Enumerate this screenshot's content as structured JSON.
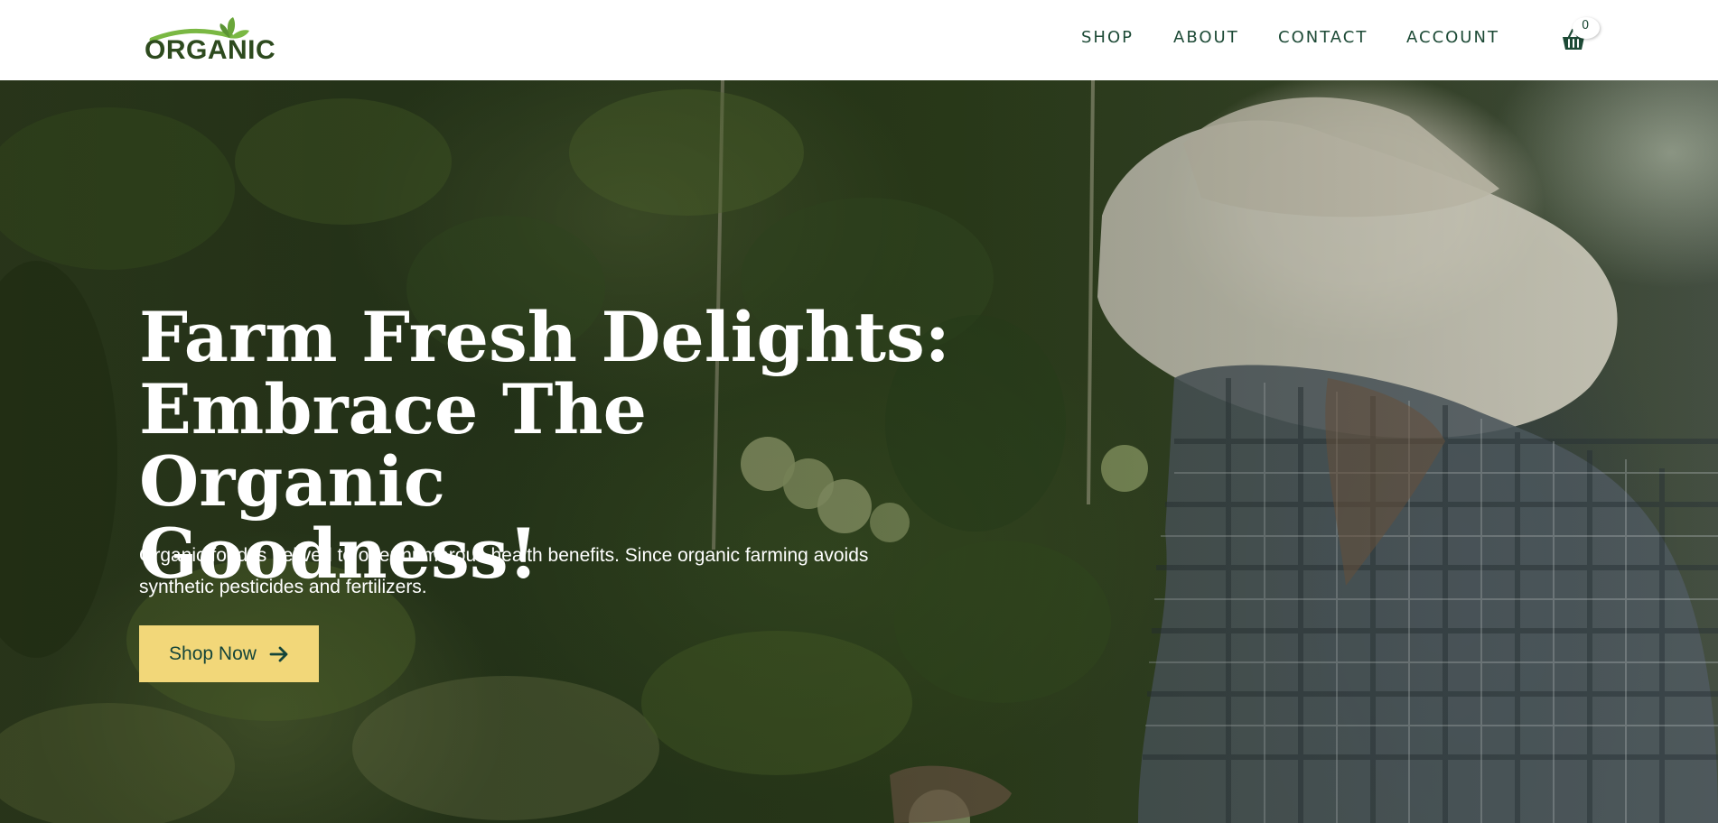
{
  "header": {
    "logo_text": "ORGANIC",
    "nav": [
      {
        "label": "SHOP"
      },
      {
        "label": "ABOUT"
      },
      {
        "label": "CONTACT"
      },
      {
        "label": "ACCOUNT"
      }
    ],
    "cart": {
      "icon": "basket-icon",
      "count": "0"
    }
  },
  "hero": {
    "title_line1": "Farm Fresh Delights:",
    "title_line2": "Embrace The Organic",
    "title_line3": "Goodness!",
    "subtitle_line1": "Organic food is belived to offer numerous health benefits. Since organic farming avoids",
    "subtitle_line2": "synthetic pesticides and fertilizers.",
    "cta_label": "Shop Now",
    "cta_icon": "arrow-right-icon"
  },
  "colors": {
    "brand_green": "#2d4a1e",
    "nav_text": "#1d4a36",
    "cta_background": "#f2d779",
    "cta_text": "#14453a"
  }
}
